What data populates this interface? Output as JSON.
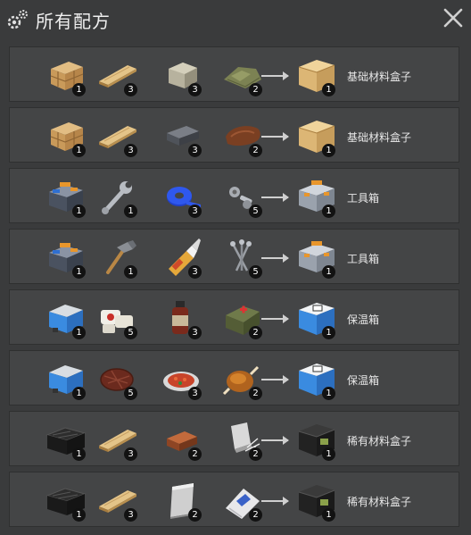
{
  "header": {
    "title": "所有配方"
  },
  "recipes": [
    {
      "ingredients": [
        {
          "icon": "wooden-crate-icon",
          "count": "1"
        },
        {
          "icon": "wood-plank-icon",
          "count": "3"
        },
        {
          "icon": "stone-icon",
          "count": "3"
        },
        {
          "icon": "cloth-icon",
          "count": "2"
        }
      ],
      "result": {
        "icon": "basic-material-box-icon",
        "count": "1",
        "name": "基础材料盒子"
      }
    },
    {
      "ingredients": [
        {
          "icon": "wooden-crate-icon",
          "count": "1"
        },
        {
          "icon": "wood-plank-icon",
          "count": "3"
        },
        {
          "icon": "iron-ingot-icon",
          "count": "3"
        },
        {
          "icon": "leather-icon",
          "count": "2"
        }
      ],
      "result": {
        "icon": "basic-material-box-icon",
        "count": "1",
        "name": "基础材料盒子"
      }
    },
    {
      "ingredients": [
        {
          "icon": "open-toolbox-icon",
          "count": "1"
        },
        {
          "icon": "wrench-icon",
          "count": "1"
        },
        {
          "icon": "duct-tape-icon",
          "count": "3"
        },
        {
          "icon": "bolts-icon",
          "count": "5"
        }
      ],
      "result": {
        "icon": "toolbox-icon",
        "count": "1",
        "name": "工具箱"
      }
    },
    {
      "ingredients": [
        {
          "icon": "open-toolbox-icon",
          "count": "1"
        },
        {
          "icon": "hammer-icon",
          "count": "1"
        },
        {
          "icon": "glue-icon",
          "count": "3"
        },
        {
          "icon": "nails-icon",
          "count": "5"
        }
      ],
      "result": {
        "icon": "toolbox-icon",
        "count": "1",
        "name": "工具箱"
      }
    },
    {
      "ingredients": [
        {
          "icon": "open-cooler-icon",
          "count": "1"
        },
        {
          "icon": "bandage-icon",
          "count": "5"
        },
        {
          "icon": "medicine-bottle-icon",
          "count": "3"
        },
        {
          "icon": "first-aid-bag-icon",
          "count": "2"
        }
      ],
      "result": {
        "icon": "cooler-box-icon",
        "count": "1",
        "name": "保温箱"
      }
    },
    {
      "ingredients": [
        {
          "icon": "open-cooler-icon",
          "count": "1"
        },
        {
          "icon": "steak-icon",
          "count": "5"
        },
        {
          "icon": "food-plate-icon",
          "count": "3"
        },
        {
          "icon": "roast-chicken-icon",
          "count": "2"
        }
      ],
      "result": {
        "icon": "cooler-box-icon",
        "count": "1",
        "name": "保温箱"
      }
    },
    {
      "ingredients": [
        {
          "icon": "open-black-crate-icon",
          "count": "1"
        },
        {
          "icon": "wood-plank-icon",
          "count": "3"
        },
        {
          "icon": "copper-ingot-icon",
          "count": "2"
        },
        {
          "icon": "metal-scraps-icon",
          "count": "2"
        }
      ],
      "result": {
        "icon": "rare-material-box-icon",
        "count": "1",
        "name": "稀有材料盒子"
      }
    },
    {
      "ingredients": [
        {
          "icon": "open-black-crate-icon",
          "count": "1"
        },
        {
          "icon": "wood-plank-icon",
          "count": "3"
        },
        {
          "icon": "metal-sheet-icon",
          "count": "2"
        },
        {
          "icon": "cement-bag-icon",
          "count": "2"
        }
      ],
      "result": {
        "icon": "rare-material-box-icon",
        "count": "1",
        "name": "稀有材料盒子"
      }
    }
  ]
}
